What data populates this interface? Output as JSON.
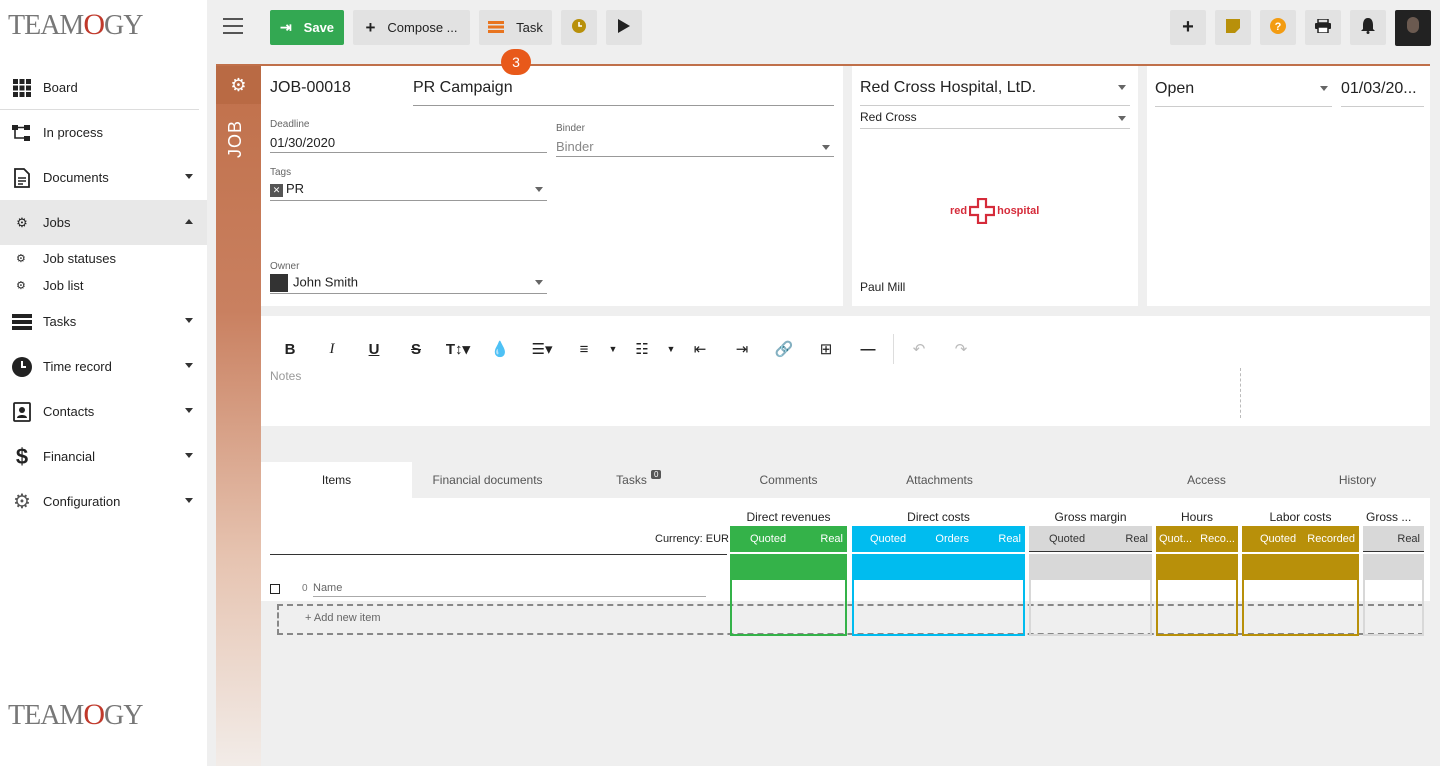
{
  "brand": {
    "logo_prefix": "TEAM",
    "logo_mid": "O",
    "logo_suffix": "GY"
  },
  "sidebar": {
    "items": [
      {
        "label": "Board",
        "icon": "grid-icon"
      },
      {
        "label": "In process",
        "icon": "flow-icon"
      },
      {
        "label": "Documents",
        "icon": "document-icon"
      },
      {
        "label": "Jobs",
        "icon": "gears-icon"
      },
      {
        "label": "Job statuses",
        "icon": "gears-icon"
      },
      {
        "label": "Job list",
        "icon": "gears-icon"
      },
      {
        "label": "Tasks",
        "icon": "tasks-icon"
      },
      {
        "label": "Time record",
        "icon": "clock-icon"
      },
      {
        "label": "Contacts",
        "icon": "contacts-icon"
      },
      {
        "label": "Financial",
        "icon": "dollar-icon"
      },
      {
        "label": "Configuration",
        "icon": "gear-icon"
      }
    ]
  },
  "toolbar": {
    "save_label": "Save",
    "compose_label": "Compose ...",
    "task_label": "Task",
    "task_badge": "3"
  },
  "job": {
    "side_label": "JOB",
    "number": "JOB-00018",
    "name": "PR Campaign",
    "deadline_label": "Deadline",
    "deadline": "01/30/2020",
    "binder_label": "Binder",
    "binder_placeholder": "Binder",
    "tags_label": "Tags",
    "tag": "PR",
    "owner_label": "Owner",
    "owner": "John Smith"
  },
  "client": {
    "company": "Red Cross Hospital, LtD.",
    "short": "Red Cross",
    "logo_left": "red",
    "logo_right": "hospital",
    "contact": "Paul Mill"
  },
  "status": {
    "value": "Open",
    "date": "01/03/20..."
  },
  "notes": {
    "placeholder": "Notes"
  },
  "tabs": [
    {
      "label": "Items"
    },
    {
      "label": "Financial documents"
    },
    {
      "label": "Tasks",
      "count": "0"
    },
    {
      "label": "Comments"
    },
    {
      "label": "Attachments"
    },
    {
      "label": "Access"
    },
    {
      "label": "History"
    }
  ],
  "items_grid": {
    "currency": "Currency: EUR",
    "row_number": "0",
    "name_placeholder": "Name",
    "add_item": "Add new item",
    "groups": [
      {
        "title": "Direct revenues",
        "color": "#34b249",
        "subs": [
          "Quoted",
          "Real"
        ]
      },
      {
        "title": "Direct costs",
        "color": "#00bcef",
        "subs": [
          "Quoted",
          "Orders",
          "Real"
        ]
      },
      {
        "title": "Gross margin",
        "color": "#d8d8d8",
        "subs": [
          "Quoted",
          "Real"
        ]
      },
      {
        "title": "Hours",
        "color": "#b8900a",
        "subs": [
          "Quot...",
          "Reco..."
        ]
      },
      {
        "title": "Labor costs",
        "color": "#b8900a",
        "subs": [
          "Quoted",
          "Recorded"
        ]
      },
      {
        "title": "Gross ...",
        "color": "#d8d8d8",
        "subs": [
          "Real"
        ]
      }
    ]
  }
}
